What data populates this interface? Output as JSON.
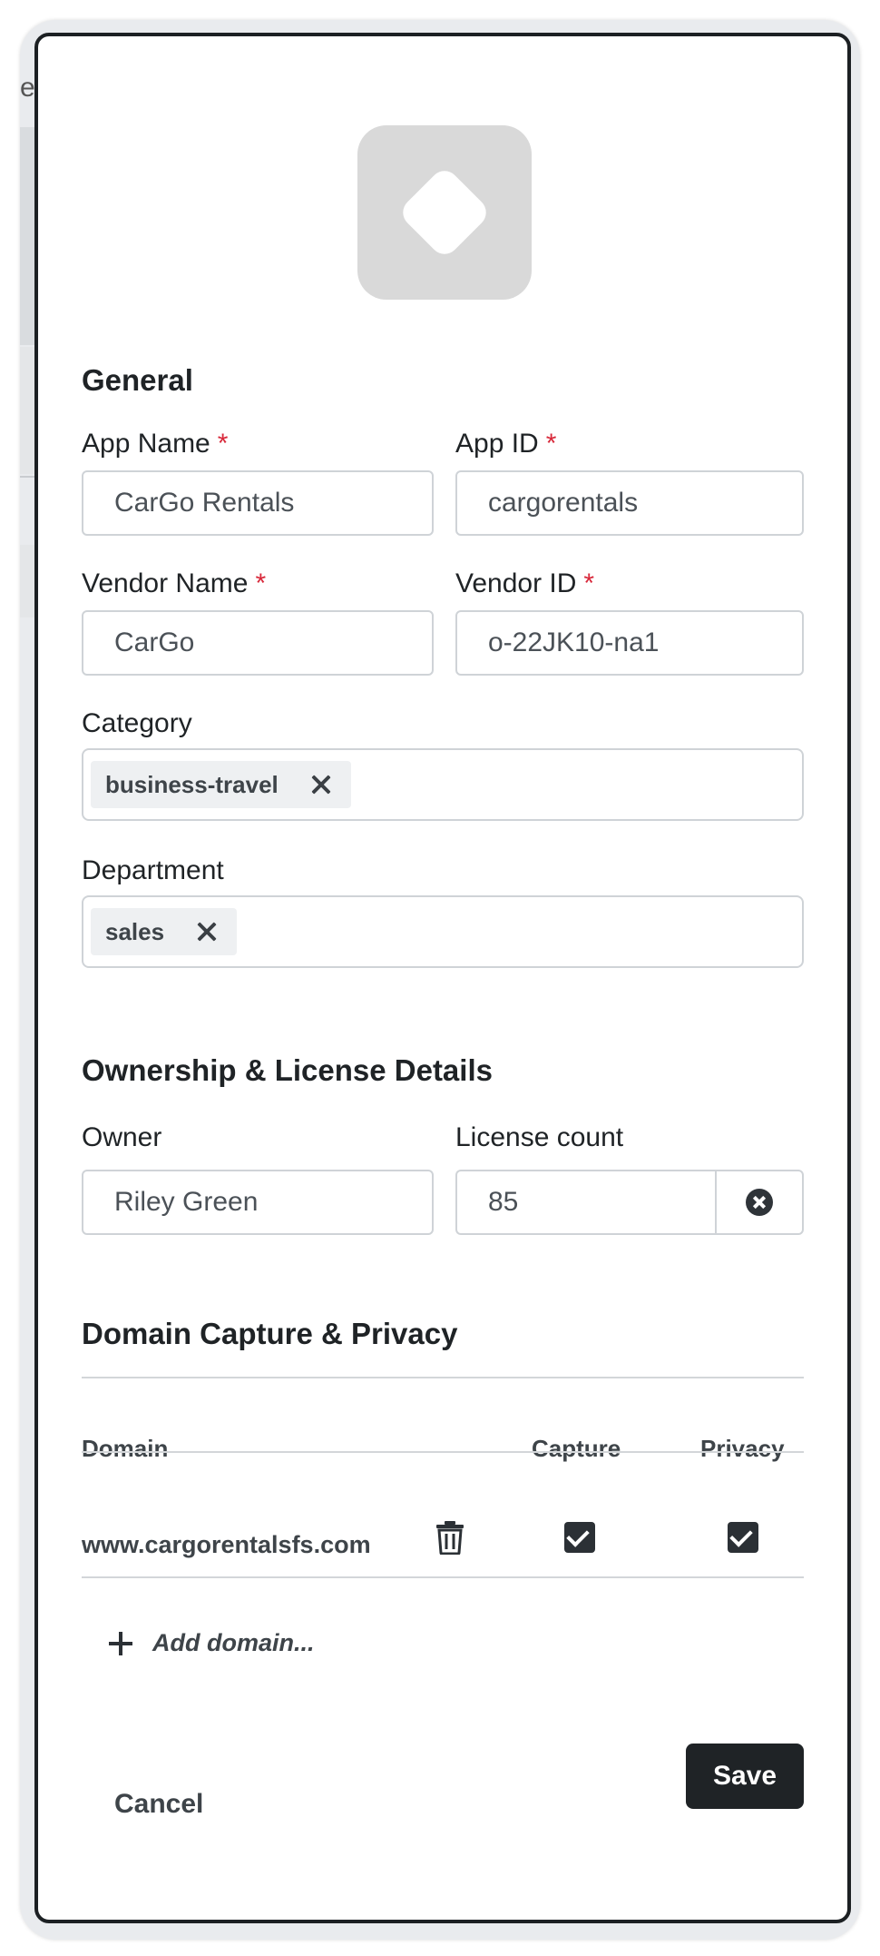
{
  "background": {
    "partial_letter": "e"
  },
  "modal": {
    "app_icon": "diamond-icon",
    "general": {
      "title": "General",
      "app_name_label": "App Name",
      "app_name_value": "CarGo Rentals",
      "app_id_label": "App ID",
      "app_id_value": "cargorentals",
      "vendor_name_label": "Vendor Name",
      "vendor_name_value": "CarGo",
      "vendor_id_label": "Vendor ID",
      "vendor_id_value": "o-22JK10-na1",
      "required_marker": "*",
      "category_label": "Category",
      "category_tags": [
        "business-travel"
      ],
      "department_label": "Department",
      "department_tags": [
        "sales"
      ]
    },
    "ownership": {
      "title": "Ownership & License Details",
      "owner_label": "Owner",
      "owner_value": "Riley Green",
      "license_label": "License count",
      "license_value": "85"
    },
    "domains": {
      "title": "Domain Capture & Privacy",
      "columns": [
        "Domain",
        "Capture",
        "Privacy"
      ],
      "rows": [
        {
          "domain": "www.cargorentalsfs.com",
          "capture": true,
          "privacy": true
        }
      ],
      "add_label": "Add domain..."
    },
    "actions": {
      "cancel": "Cancel",
      "save": "Save"
    }
  },
  "colors": {
    "accent_dark": "#1f2326",
    "required": "#d8283a",
    "border": "#cfd3d7"
  }
}
